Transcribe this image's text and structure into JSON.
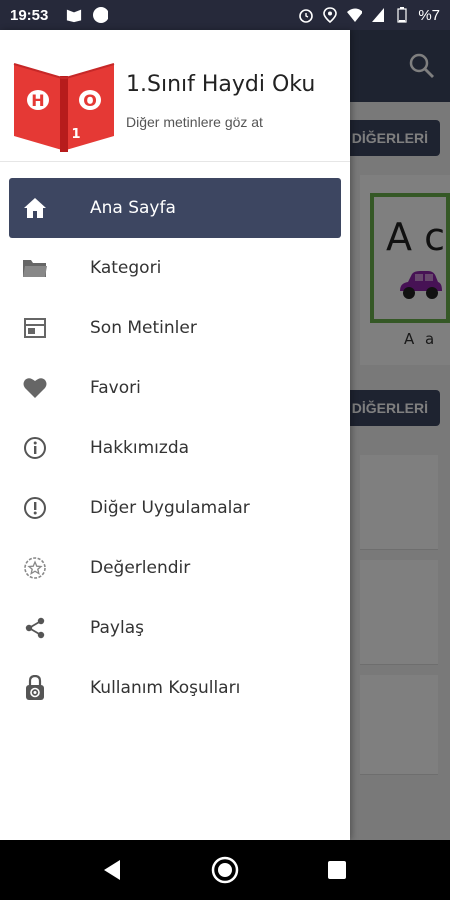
{
  "status_bar": {
    "time": "19:53",
    "battery": "%7"
  },
  "background": {
    "more_button_label": "DİĞERLERİ",
    "card_caption": "A a",
    "card_letter": "A c"
  },
  "drawer": {
    "title": "1.Sınıf Haydi Oku",
    "subtitle": "Diğer metinlere göz at",
    "logo_letters": [
      "H",
      "O",
      "1"
    ],
    "items": [
      {
        "label": "Ana Sayfa",
        "icon": "home-icon",
        "active": true
      },
      {
        "label": "Kategori",
        "icon": "folder-icon",
        "active": false
      },
      {
        "label": "Son Metinler",
        "icon": "recent-icon",
        "active": false
      },
      {
        "label": "Favori",
        "icon": "heart-icon",
        "active": false
      },
      {
        "label": "Hakkımızda",
        "icon": "info-icon",
        "active": false
      },
      {
        "label": "Diğer Uygulamalar",
        "icon": "alert-circle-icon",
        "active": false
      },
      {
        "label": "Değerlendir",
        "icon": "star-badge-icon",
        "active": false
      },
      {
        "label": "Paylaş",
        "icon": "share-icon",
        "active": false
      },
      {
        "label": "Kullanım Koşulları",
        "icon": "lock-gear-icon",
        "active": false
      }
    ]
  },
  "colors": {
    "primary": "#3d4661",
    "logo_red": "#e53935",
    "logo_dark_red": "#b71c1c"
  }
}
